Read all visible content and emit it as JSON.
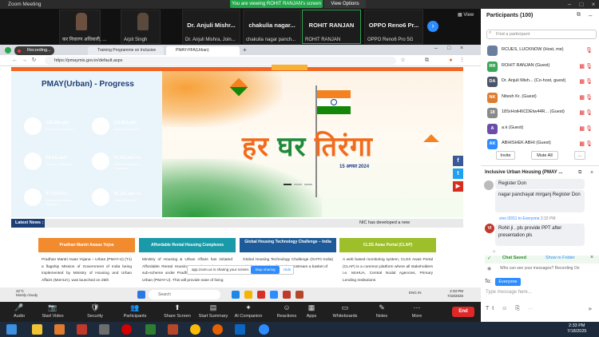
{
  "app": {
    "title": "Zoom Meeting",
    "viewing_banner": "You are viewing ROHIT RANJAN's screen",
    "view_options": "View Options",
    "view_label": "View"
  },
  "strip": {
    "tiles": [
      {
        "name": "कर निवारण अधिकारी, ..."
      },
      {
        "name": "Arpit Singh"
      },
      {
        "big": "Dr. Anjuli Mishr...",
        "name": "Dr. Anjuli Mishra, Join..."
      },
      {
        "big": "chakulia nagar...",
        "name": "chakulia nagar panch..."
      },
      {
        "big": "ROHIT RANJAN",
        "name": "ROHIT RANJAN"
      },
      {
        "big": "OPPO Reno6 Pr...",
        "name": "OPPO Reno6 Pro 5G"
      }
    ]
  },
  "browser": {
    "recording": "Recording...",
    "tabs": [
      "Training Programme on Inclusive",
      "PMAY-HFA(Urban)"
    ],
    "url": "https://pmaymis.gov.in/default.aspx"
  },
  "site": {
    "progress_title": "PMAY(Urban) - Progress",
    "cards": [
      {
        "value": "118.26Lakh",
        "label": "Houses Sanctioned",
        "color": "#2aa79b"
      },
      {
        "value": "112.81Lakh",
        "label": "Houses Grounded",
        "color": "#c43c6c"
      },
      {
        "value": "93.01Lakh",
        "label": "Houses Completed",
        "color": "#f58a3a"
      },
      {
        "value": "₹2.01Lakh Cr.",
        "label": "Central Assistance Committed",
        "color": "#b02a3a"
      },
      {
        "value": "₹172334Cr.",
        "label": "Central Assistance Released",
        "color": "#1c5a9a"
      },
      {
        "value": "₹8.15Lakh Cr.",
        "label": "Total Investment",
        "color": "#2ba36a"
      }
    ],
    "banner_text_a": "हर",
    "banner_text_b": "घर",
    "banner_text_c": "तिरंगा",
    "banner_date": "15 अगस्त 2024",
    "latest_label": "Latest News :",
    "latest_text": "NIC has developed a new",
    "sections": [
      {
        "title": "Pradhan Mantri Awaas Yojna",
        "color": "#f28a2e",
        "body": "Pradhan Mantri Awas Yojana – Urban (PMAY-U) (T1) a flagship Mission of Government of India being implemented by Ministry of Housing and Urban Affairs (MoHUA), was launched on 25th"
      },
      {
        "title": "Affordable Rental Housing Complexes",
        "color": "#1a9aa8",
        "body": "Ministry of Housing & Urban Affairs has initiated Affordable Rental Housing Complexes (ARHCs), a sub-scheme under Pradhan Mantri Awas Yojana - Urban (PMAY-U). This will provide ease of living"
      },
      {
        "title": "Global Housing Technology Challenge – India",
        "color": "#1c5a9a",
        "body": "Global Housing Technology Challenge (GHTC-India) which aims to identify and mainstream a basket of"
      },
      {
        "title": "CLSS Awas Portal (CLAP)",
        "color": "#9cbf2a",
        "body": "A web based monitoring system, CLSS Awas Portal (CLAP) is a common platform where all stakeholders i.e. MoHUA, Central Nodal Agencies, Primary Lending Institutions"
      }
    ],
    "sharing_text": "app.zoom.us is sharing your screen.",
    "stop_sharing": "Stop sharing",
    "hide": "Hide"
  },
  "shared_taskbar": {
    "weather_temp": "32°C",
    "weather_desc": "Mostly cloudy",
    "search": "Search",
    "time": "2:33 PM",
    "date": "7/18/2025",
    "lang": "ENG IN"
  },
  "toolbar": [
    {
      "label": "Audio",
      "icon": "🎤"
    },
    {
      "label": "Start Video",
      "icon": "📷"
    },
    {
      "label": "Security",
      "icon": "🛡"
    },
    {
      "label": "Participants",
      "icon": "👥",
      "badge": "100"
    },
    {
      "label": "Share Screen",
      "icon": "⬆"
    },
    {
      "label": "Start Summary",
      "icon": "▤"
    },
    {
      "label": "AI Companion",
      "icon": "✦"
    },
    {
      "label": "Reactions",
      "icon": "☺"
    },
    {
      "label": "Apps",
      "icon": "▦"
    },
    {
      "label": "Whiteboards",
      "icon": "▭"
    },
    {
      "label": "Notes",
      "icon": "✎"
    },
    {
      "label": "More",
      "icon": "⋯"
    }
  ],
  "end_label": "End",
  "participants": {
    "header": "Participants (100)",
    "search_placeholder": "Find a participant",
    "rows": [
      {
        "initials": "",
        "name": "RCUES, LUCKNOW (Host, me)",
        "color": "#6a7fa0"
      },
      {
        "initials": "RR",
        "name": "ROHIT RANJAN (Guest)",
        "color": "#3aa657"
      },
      {
        "initials": "DA",
        "name": "Dr. Anjuli Mish... (Co-host, guest)",
        "color": "#4a5568"
      },
      {
        "initials": "NK",
        "name": "Nitesh Kr. (Guest)",
        "color": "#e07a2e"
      },
      {
        "initials": "18",
        "name": "18SrHotH6CDEtw44R... (Guest)",
        "color": "#8a8a8a"
      },
      {
        "initials": "A",
        "name": "a.k (Guest)",
        "color": "#6b4ca8"
      },
      {
        "initials": "AK",
        "name": "ABHISHEK ABHI (Guest)",
        "color": "#2d8cff"
      }
    ],
    "invite": "Invite",
    "mute_all": "Mute All"
  },
  "chat": {
    "header": "Inclusive Urban Housing (PMAY ...",
    "messages": [
      "Register Don",
      "nagar panchayat mirganj Register Don"
    ],
    "sender": "vivo I2011 to Everyone",
    "sender_time": "2:32 PM",
    "sender_initials": "VI",
    "last_message": "Rohit ji , pls provide PPT after presentation pls",
    "chat_saved": "Chat Saved",
    "show_in_folder": "Show in Folder",
    "who_can_see": "Who can see your messages? Recording On",
    "to_label": "To:",
    "to_value": "Everyone",
    "placeholder": "Type message here..."
  },
  "clock": {
    "time": "2:33 PM",
    "date": "7/18/2025"
  }
}
